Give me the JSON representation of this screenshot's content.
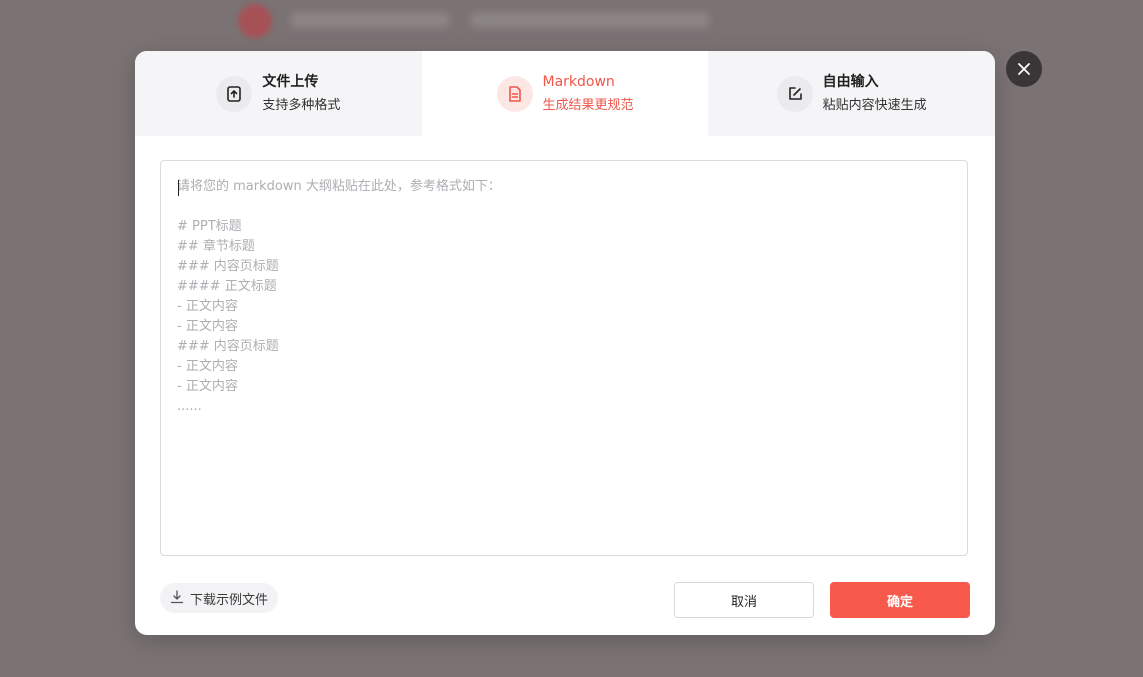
{
  "tabs": [
    {
      "title": "文件上传",
      "subtitle": "支持多种格式",
      "icon": "upload-file-icon",
      "active": false
    },
    {
      "title": "Markdown",
      "subtitle": "生成结果更规范",
      "icon": "document-icon",
      "active": true
    },
    {
      "title": "自由输入",
      "subtitle": "粘贴内容快速生成",
      "icon": "edit-icon",
      "active": false
    }
  ],
  "editor": {
    "placeholder_intro": "请将您的 markdown 大纲粘贴在此处，参考格式如下：",
    "placeholder_lines": [
      "# PPT标题",
      "## 章节标题",
      "### 内容页标题",
      "#### 正文标题",
      "- 正文内容",
      "- 正文内容",
      "### 内容页标题",
      "- 正文内容",
      "- 正文内容",
      "......"
    ]
  },
  "footer": {
    "download_label": "下载示例文件",
    "cancel_label": "取消",
    "confirm_label": "确定"
  },
  "colors": {
    "accent": "#f8594d",
    "active_tab_text": "#f0564a",
    "overlay": "#7a7273"
  },
  "close_icon": "close-icon"
}
